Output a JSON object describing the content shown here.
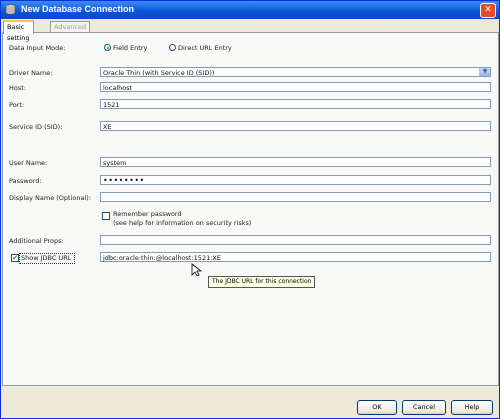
{
  "window": {
    "title": "New Database Connection"
  },
  "tabs": [
    "Basic setting",
    "Advanced"
  ],
  "form": {
    "data_input_mode": {
      "label": "Data Input Mode:",
      "options": [
        "Field Entry",
        "Direct URL Entry"
      ],
      "selected": "Field Entry"
    },
    "driver": {
      "label": "Driver Name:",
      "value": "Oracle Thin (with Service ID (SID))"
    },
    "host": {
      "label": "Host:",
      "value": "localhost"
    },
    "port": {
      "label": "Port:",
      "value": "1521"
    },
    "sid": {
      "label": "Service ID (SID):",
      "value": "XE"
    },
    "user": {
      "label": "User Name:",
      "value": "system"
    },
    "password": {
      "label": "Password:",
      "value": "••••••••"
    },
    "display_name": {
      "label": "Display Name (Optional):",
      "value": ""
    },
    "remember_password": {
      "label": "Remember password",
      "hint": "(see help for information on security risks)",
      "checked": false
    },
    "additional_props": {
      "label": "Additional Props:",
      "value": ""
    },
    "show_jdbc_url": {
      "label": "Show JDBC URL",
      "checked": true
    },
    "jdbc_url": {
      "value": "jdbc:oracle:thin:@localhost:1521:XE"
    }
  },
  "tooltip": "The JDBC URL for this connection",
  "buttons": {
    "ok": "OK",
    "cancel": "Cancel",
    "help": "Help"
  },
  "icons": {
    "window": "database-icon",
    "close": "close-icon",
    "dropdown": "chevron-down-icon",
    "check": "checkmark-icon"
  }
}
